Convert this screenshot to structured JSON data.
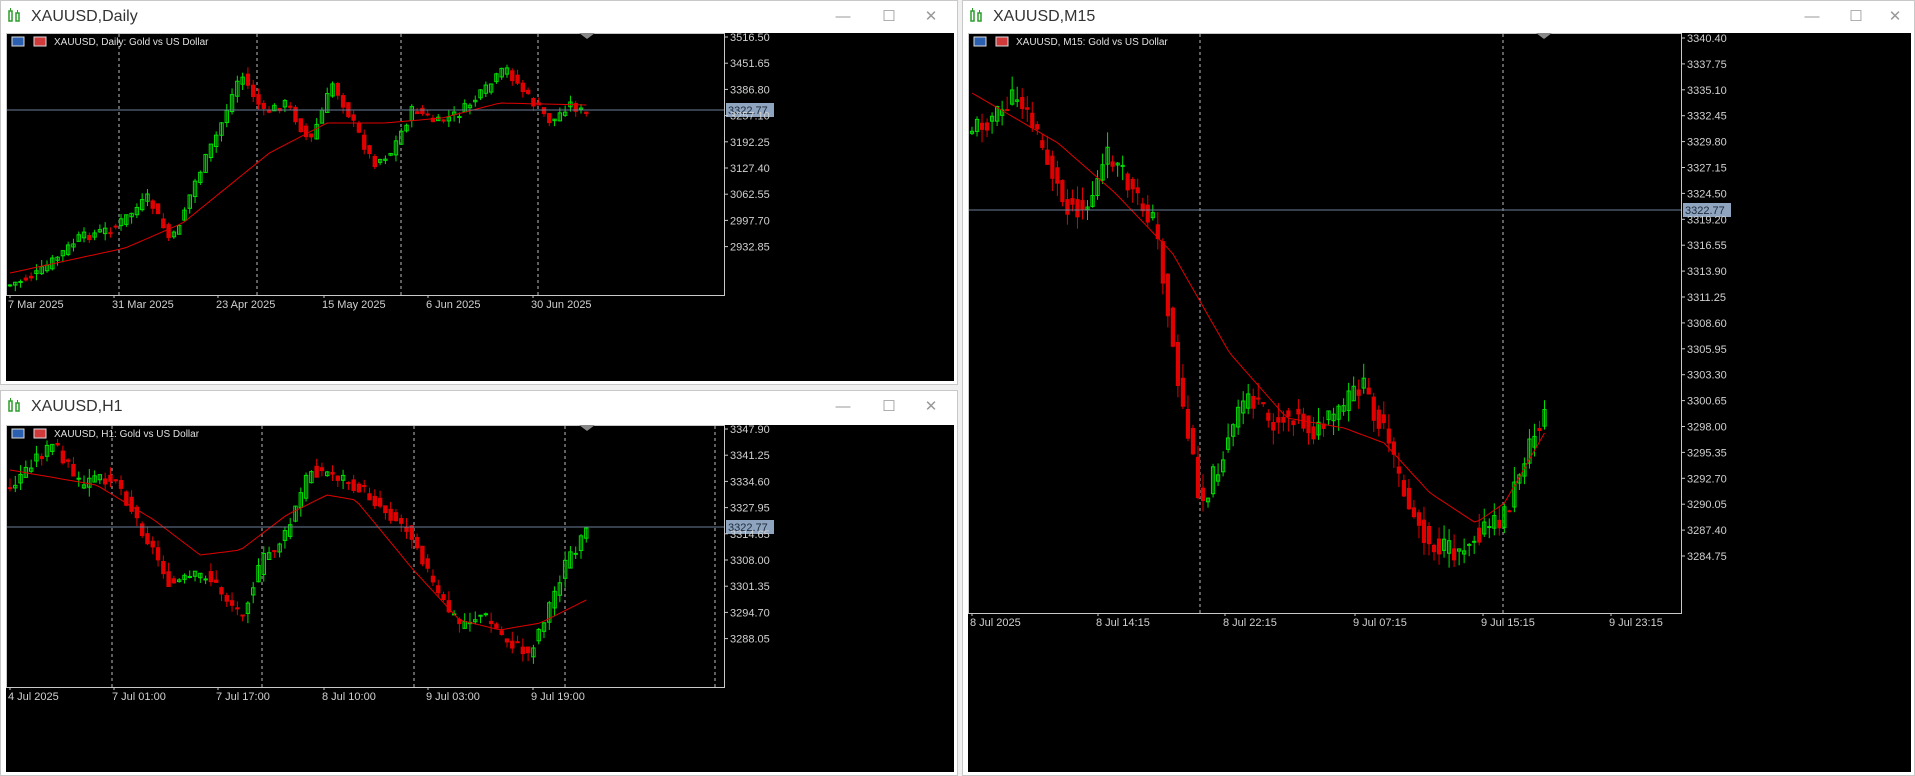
{
  "windows": [
    {
      "id": "daily",
      "title": "XAUUSD,Daily",
      "header": "XAUUSD, Daily:  Gold vs US Dollar",
      "price_labels": [
        "3516.50",
        "3451.65",
        "3386.80",
        "3322.77",
        "3257.10",
        "3192.25",
        "3127.40",
        "3062.55",
        "2997.70",
        "2932.85"
      ],
      "date_labels": [
        "7 Mar 2025",
        "31 Mar 2025",
        "23 Apr 2025",
        "15 May 2025",
        "6 Jun 2025",
        "30 Jun 2025"
      ]
    },
    {
      "id": "h1",
      "title": "XAUUSD,H1",
      "header": "XAUUSD, H1:  Gold vs US Dollar",
      "price_labels": [
        "3347.90",
        "3341.25",
        "3334.60",
        "3327.95",
        "3322.77",
        "3314.65",
        "3308.00",
        "3301.35",
        "3294.70",
        "3288.05"
      ],
      "date_labels": [
        "4 Jul 2025",
        "7 Jul 01:00",
        "7 Jul 17:00",
        "8 Jul 10:00",
        "9 Jul 03:00",
        "9 Jul 19:00"
      ]
    },
    {
      "id": "m15",
      "title": "XAUUSD,M15",
      "header": "XAUUSD, M15:  Gold vs US Dollar",
      "price_labels": [
        "3340.40",
        "3337.75",
        "3335.10",
        "3332.45",
        "3329.80",
        "3327.15",
        "3324.50",
        "3322.77",
        "3319.20",
        "3316.55",
        "3313.90",
        "3311.25",
        "3308.60",
        "3305.95",
        "3303.30",
        "3300.65",
        "3298.00",
        "3295.35",
        "3292.70",
        "3290.05",
        "3287.40",
        "3284.75"
      ],
      "date_labels": [
        "8 Jul 2025",
        "8 Jul 14:15",
        "8 Jul 22:15",
        "9 Jul 07:15",
        "9 Jul 15:15",
        "9 Jul 23:15"
      ]
    }
  ],
  "colors": {
    "bull": "#00e000",
    "bear": "#e00000",
    "ma": "#e00000",
    "bid_line": "#6a7f99",
    "bid_tag": "#8ea4bf",
    "grid": "#c8c8c8",
    "axis_text": "#d0d0d0"
  },
  "window_buttons": {
    "minimize": "—",
    "maximize": "☐",
    "close": "✕"
  }
}
